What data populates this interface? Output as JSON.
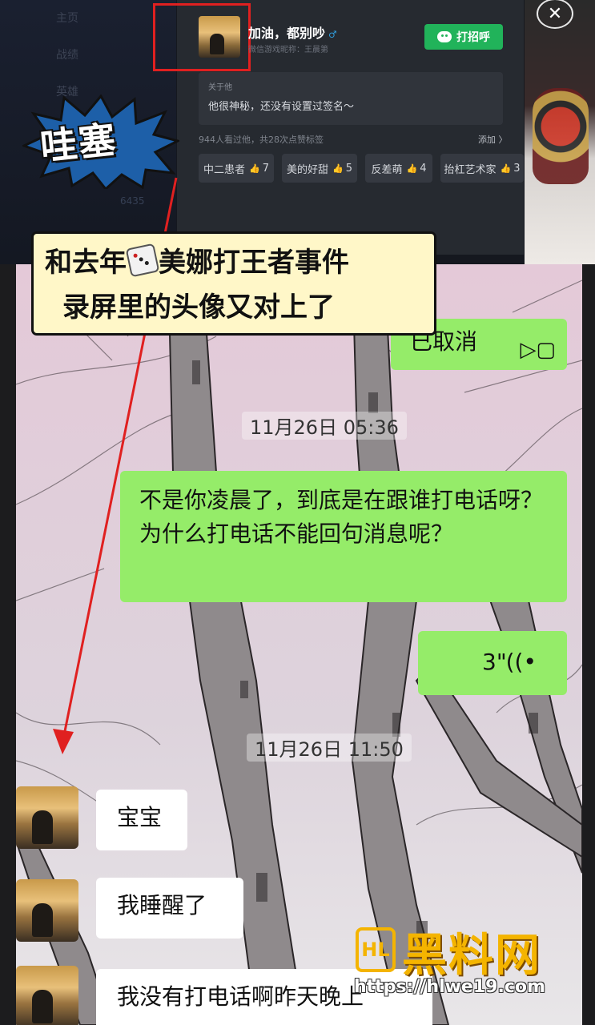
{
  "profile_card": {
    "username": "加油，都别吵",
    "gender_icon": "male-icon",
    "nickname_line": "微信游戏昵称：王晨第",
    "greet_button": "打招呼",
    "about_title": "关于他",
    "about_text": "他很神秘，还没有设置过签名～",
    "visits_text": "944人看过他，共28次点赞标签",
    "add_text": "添加 〉",
    "tags": [
      {
        "label": "中二患者",
        "count": "7"
      },
      {
        "label": "美的好甜",
        "count": "5"
      },
      {
        "label": "反差萌",
        "count": "4"
      },
      {
        "label": "抬杠艺术家",
        "count": "3"
      }
    ],
    "close_glyph": "✕"
  },
  "side_menu": {
    "items": [
      "主页",
      "战绩",
      "英雄"
    ],
    "number": "6435"
  },
  "overlay": {
    "burst_text": "哇塞",
    "caption_line1_a": "和去年",
    "caption_line1_b": "美娜打王者事件",
    "caption_line2": "录屏里的头像又对上了"
  },
  "chat": {
    "messages": [
      {
        "side": "right",
        "type": "call",
        "text": "已取消",
        "icon": "phone-icon"
      },
      {
        "type": "time",
        "text": "11月26日 05:36"
      },
      {
        "side": "right",
        "type": "text",
        "text": "不是你凌晨了，到底是在跟谁打电话呀？为什么打电话不能回句消息呢？"
      },
      {
        "side": "right",
        "type": "voice",
        "text": "3\"",
        "icon": "voice-wave-icon"
      },
      {
        "type": "time",
        "text": "11月26日 11:50"
      },
      {
        "side": "left",
        "type": "text",
        "text": "宝宝"
      },
      {
        "side": "left",
        "type": "text",
        "text": "我睡醒了"
      },
      {
        "side": "left",
        "type": "text",
        "text": "我没有打电话啊昨天晚上"
      }
    ]
  },
  "watermark": {
    "logo": "HL",
    "name": "黑料网",
    "url": "https://hlwe19.com"
  },
  "colors": {
    "bubble_green": "#95ec69",
    "highlight_red": "#e02020",
    "greet_green": "#21b35a",
    "watermark_gold": "#f4b400"
  }
}
